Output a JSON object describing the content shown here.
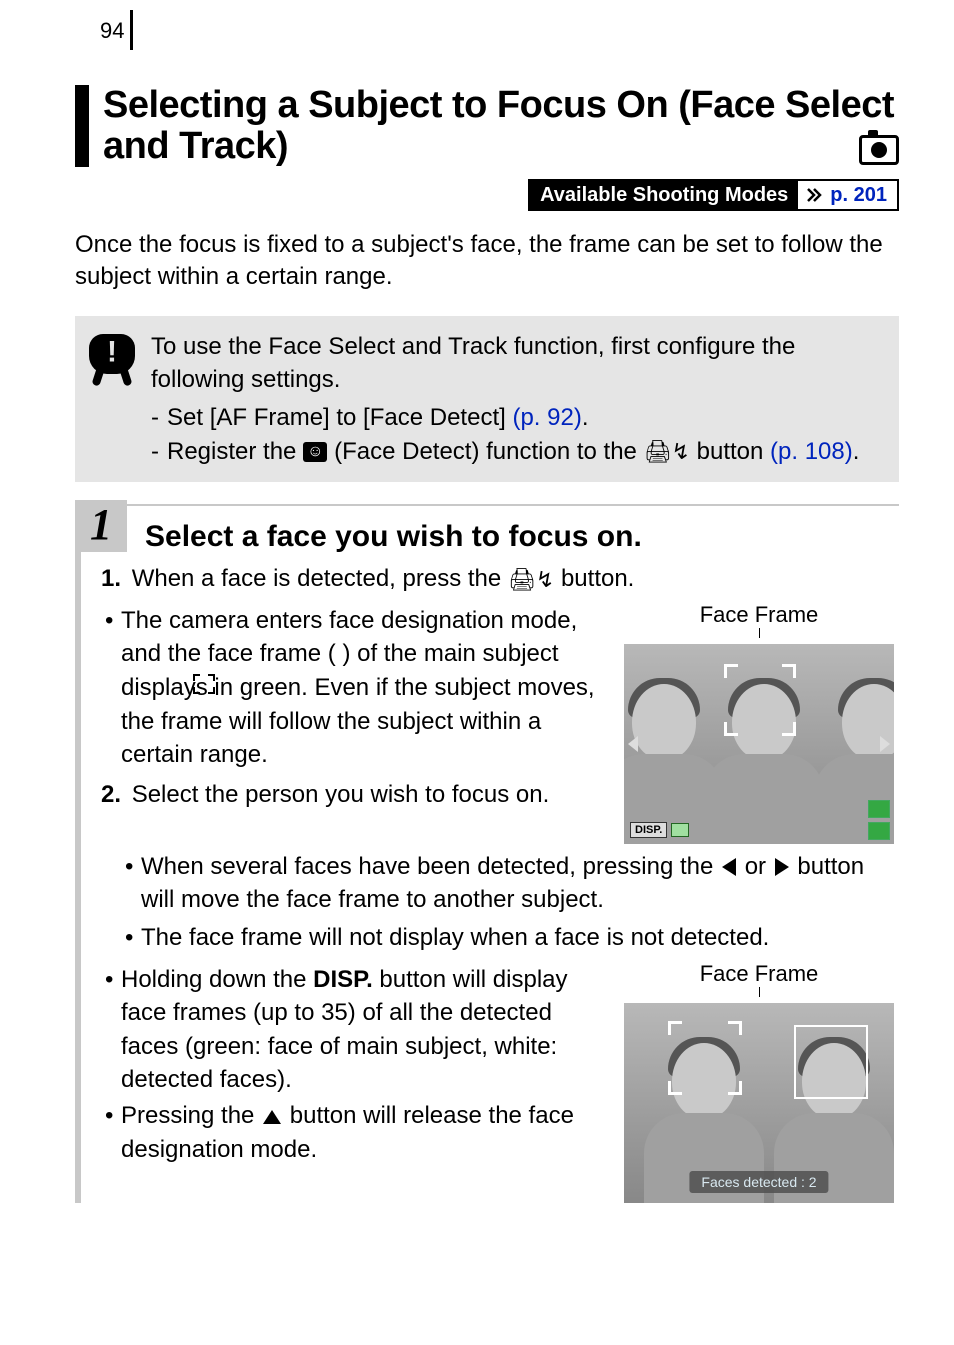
{
  "page_number": "94",
  "heading": "Selecting a Subject to Focus On (Face Select and Track)",
  "modes_label": "Available Shooting Modes",
  "modes_link": "p. 201",
  "intro": "Once the focus is fixed to a subject's face, the frame can be set to follow the subject within a certain range.",
  "warning": {
    "lead": "To use the Face Select and Track function, first configure the following settings.",
    "item1_prefix": "Set [AF Frame] to [Face Detect] ",
    "item1_link": "(p. 92)",
    "item1_suffix": ".",
    "item2_prefix": "Register the ",
    "item2_mid": " (Face Detect) function to the ",
    "item2_suffix": " button ",
    "item2_link": "(p. 108)",
    "item2_suffix2": "."
  },
  "step": {
    "number": "1",
    "title": "Select a face you wish to focus on.",
    "sub1_prefix": "When a face is detected, press the ",
    "sub1_suffix": " button.",
    "bullet1": "The camera enters face designation mode, and the face frame (      ) of the main subject displays in green. Even if the subject moves, the frame will follow the subject within a certain range.",
    "sub2": "Select the person you wish to focus on.",
    "caption1": "Face Frame",
    "disp_label": "DISP.",
    "bullet2a": "When several faces have been detected, pressing the ",
    "bullet2b": " or ",
    "bullet2c": " button will move the face frame to another subject.",
    "bullet3": "The face frame will not display when a face is not detected.",
    "bullet4_prefix": "Holding down the ",
    "bullet4_disp": "DISP.",
    "bullet4_suffix": " button will display face frames (up to 35) of all the detected faces (green: face of main subject, white: detected faces).",
    "bullet5_prefix": "Pressing the ",
    "bullet5_suffix": " button will release the face designation mode.",
    "caption2": "Face Frame",
    "status_text": "Faces detected : 2"
  }
}
